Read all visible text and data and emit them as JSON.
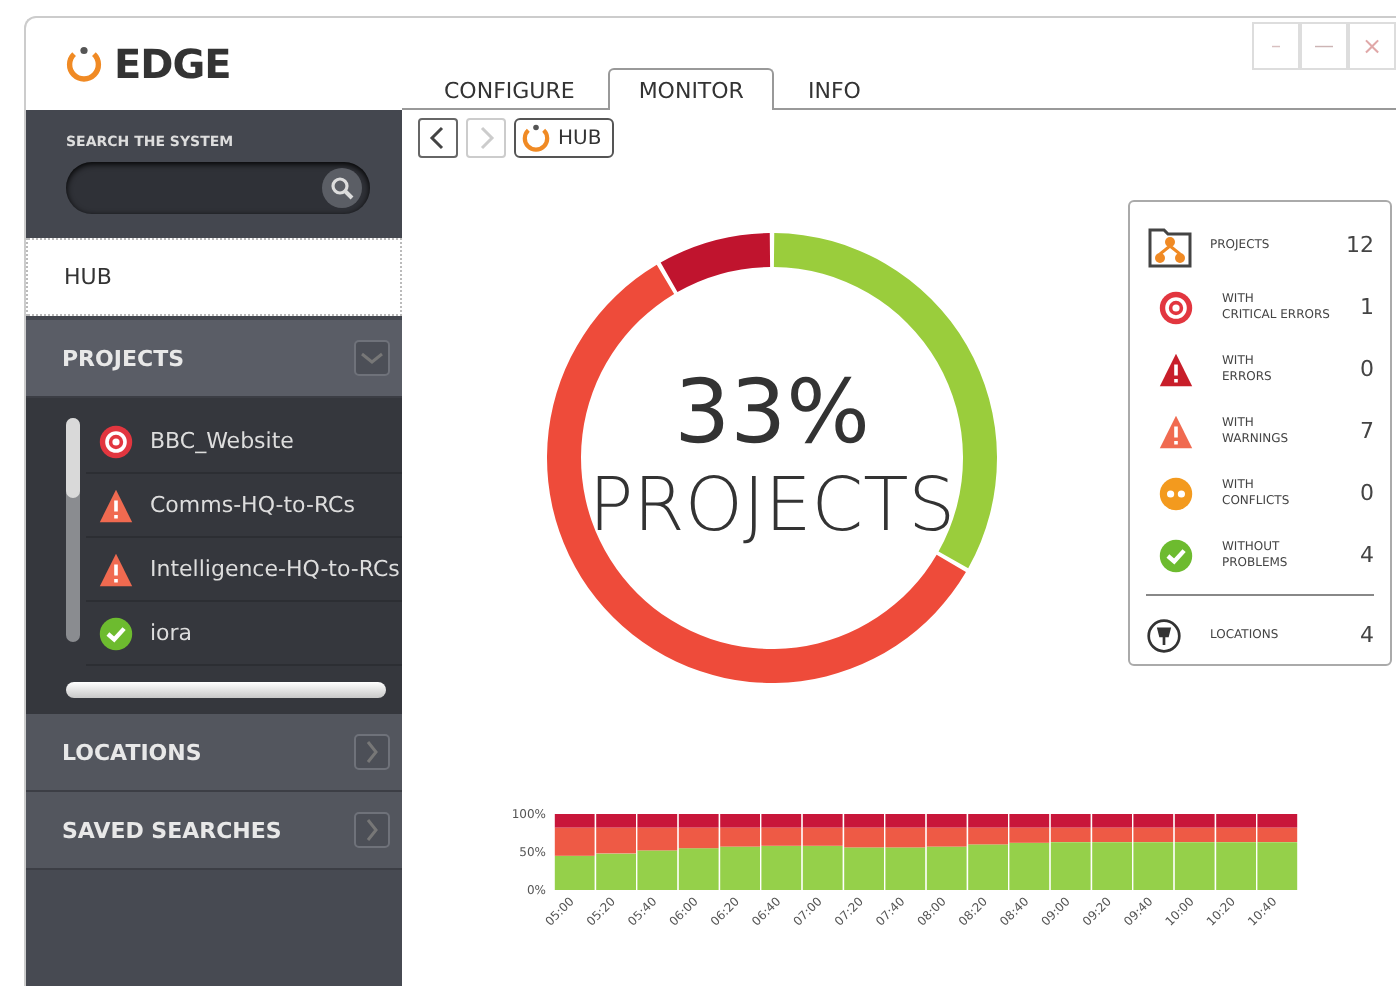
{
  "window": {
    "title": "EDGE",
    "controls": [
      {
        "kind": "minimize",
        "label": "–"
      },
      {
        "kind": "maximize",
        "label": "—"
      },
      {
        "kind": "close",
        "label": "×"
      }
    ]
  },
  "tabs": [
    {
      "label": "CONFIGURE",
      "selected": false
    },
    {
      "label": "MONITOR",
      "selected": true
    },
    {
      "label": "INFO",
      "selected": false
    }
  ],
  "search": {
    "label": "SEARCH THE SYSTEM"
  },
  "breadcrumb": {
    "back_disabled": false,
    "forward_disabled": true,
    "current": "HUB"
  },
  "sidebar": {
    "hub": {
      "label": "HUB",
      "selected": true
    },
    "sections": [
      {
        "label": "PROJECTS",
        "expanded": true,
        "items": [
          {
            "label": "BBC_Website",
            "kind": "critical"
          },
          {
            "label": "Comms-HQ-to-RCs",
            "kind": "warning"
          },
          {
            "label": "Intelligence-HQ-to-RCs",
            "kind": "warning"
          },
          {
            "label": "iora",
            "kind": "ok"
          }
        ]
      },
      {
        "label": "LOCATIONS",
        "expanded": false
      },
      {
        "label": "SAVED SEARCHES",
        "expanded": false
      }
    ]
  },
  "donut": {
    "percent": "33%",
    "caption": "PROJECTS",
    "chart_data": {
      "type": "donut",
      "values": [
        33.3,
        58.3,
        8.4
      ],
      "colors": [
        "#9acd3c",
        "#ee4b3a",
        "#c0142e"
      ]
    }
  },
  "summary": {
    "rows": [
      {
        "kind": "projects",
        "label": "PROJECTS",
        "count": "12"
      },
      {
        "kind": "critical",
        "label": "WITH\nCRITICAL ERRORS",
        "count": "1"
      },
      {
        "kind": "error",
        "label": "WITH\nERRORS",
        "count": "0"
      },
      {
        "kind": "warning",
        "label": "WITH\nWARNINGS",
        "count": "7"
      },
      {
        "kind": "conflict",
        "label": "WITH\nCONFLICTS",
        "count": "0"
      },
      {
        "kind": "ok",
        "label": "WITHOUT\nPROBLEMS",
        "count": "4"
      },
      {
        "kind": "locations",
        "label": "LOCATIONS",
        "count": "4"
      }
    ]
  },
  "trend": {
    "chart_data": {
      "type": "bar",
      "stacked": true,
      "ylim": [
        0,
        100
      ],
      "yticks": [
        {
          "value": 0,
          "label": "0%"
        },
        {
          "value": 50,
          "label": "50%"
        },
        {
          "value": 100,
          "label": "100%"
        }
      ],
      "categories": [
        "05:00",
        "05:20",
        "05:40",
        "06:00",
        "06:20",
        "06:40",
        "07:00",
        "07:20",
        "07:40",
        "08:00",
        "08:20",
        "08:40",
        "09:00",
        "09:20",
        "09:40",
        "10:00",
        "10:20",
        "10:40"
      ],
      "series": [
        {
          "color": "#95d04a",
          "values": [
            45,
            48,
            52,
            55,
            57,
            58,
            58,
            56,
            56,
            57,
            60,
            62,
            63,
            63,
            63,
            63,
            63,
            63
          ]
        },
        {
          "color": "#ee5a45",
          "values": [
            37,
            34,
            30,
            27,
            25,
            24,
            24,
            26,
            26,
            25,
            22,
            20,
            19,
            19,
            19,
            19,
            19,
            19
          ]
        },
        {
          "color": "#c8163a",
          "values": [
            18,
            18,
            18,
            18,
            18,
            18,
            18,
            18,
            18,
            18,
            18,
            18,
            18,
            18,
            18,
            18,
            18,
            18
          ]
        }
      ]
    }
  }
}
